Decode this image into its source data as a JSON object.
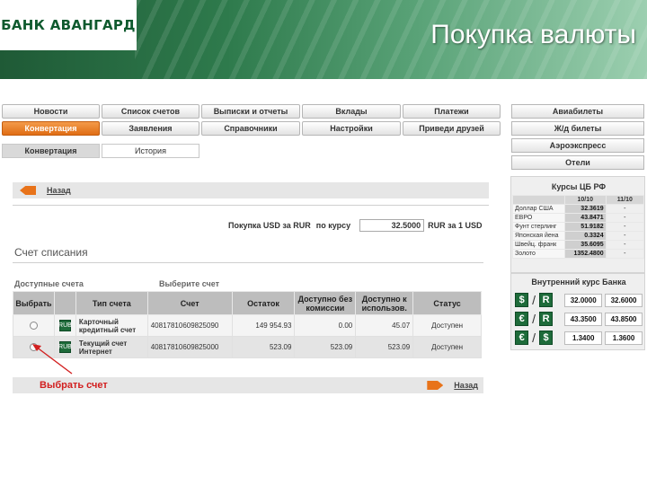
{
  "header": {
    "bank_name": "БАНК АВАНГАРД",
    "page_title": "Покупка валюты"
  },
  "nav_row1": [
    "Новости",
    "Список счетов",
    "Выписки и отчеты",
    "Вклады",
    "Платежи"
  ],
  "nav_row2": [
    "Конвертация",
    "Заявления",
    "Справочники",
    "Настройки",
    "Приведи друзей"
  ],
  "subtabs": {
    "active": "Конвертация",
    "inactive": "История"
  },
  "back_label": "Назад",
  "rate_row": {
    "label": "Покупка USD за RUR",
    "by_rate": "по курсу",
    "value": "32.5000",
    "unit": "RUR за 1 USD"
  },
  "section_title": "Счет списания",
  "available_accounts": "Доступные счета",
  "choose_account": "Выберите счет",
  "table": {
    "headers": [
      "Выбрать",
      "",
      "Тип счета",
      "Счет",
      "Остаток",
      "Доступно без комиссии",
      "Доступно к использов.",
      "Статус"
    ],
    "rows": [
      {
        "type": "Карточный кредитный счет",
        "account": "40817810609825090",
        "balance": "149 954.93",
        "no_fee": "0.00",
        "usable": "45.07",
        "status": "Доступен",
        "icon": "RUB"
      },
      {
        "type": "Текущий счет Интернет",
        "account": "40817810609825000",
        "balance": "523.09",
        "no_fee": "523.09",
        "usable": "523.09",
        "status": "Доступен",
        "icon": "RUB"
      }
    ]
  },
  "select_account_label": "Выбрать счет",
  "forward_label": "Назад",
  "right_buttons": [
    "Авиабилеты",
    "Ж/д билеты",
    "Аэроэкспресс",
    "Отели"
  ],
  "cb_rates": {
    "title": "Курсы ЦБ РФ",
    "headers": [
      "",
      "10/10",
      "11/10"
    ],
    "rows": [
      {
        "name": "Доллар США",
        "value": "32.3619",
        "change": "-"
      },
      {
        "name": "ЕВРО",
        "value": "43.8471",
        "change": "-"
      },
      {
        "name": "Фунт стерлинг",
        "value": "51.9182",
        "change": "-"
      },
      {
        "name": "Японская йена",
        "value": "0.3324",
        "change": "-"
      },
      {
        "name": "Швейц. франк",
        "value": "35.6095",
        "change": "-"
      },
      {
        "name": "Золото",
        "value": "1352.4800",
        "change": "-"
      }
    ]
  },
  "bank_rates": {
    "title": "Внутренний курс Банка",
    "rows": [
      {
        "from": "$",
        "to": "R",
        "buy": "32.0000",
        "sell": "32.6000"
      },
      {
        "from": "€",
        "to": "R",
        "buy": "43.3500",
        "sell": "43.8500"
      },
      {
        "from": "€",
        "to": "$",
        "buy": "1.3400",
        "sell": "1.3600"
      }
    ]
  },
  "colors": {
    "accent": "#e8731a",
    "brand": "#1e6b3a",
    "status": "#2e8b3a",
    "alert": "#d21f1f"
  }
}
